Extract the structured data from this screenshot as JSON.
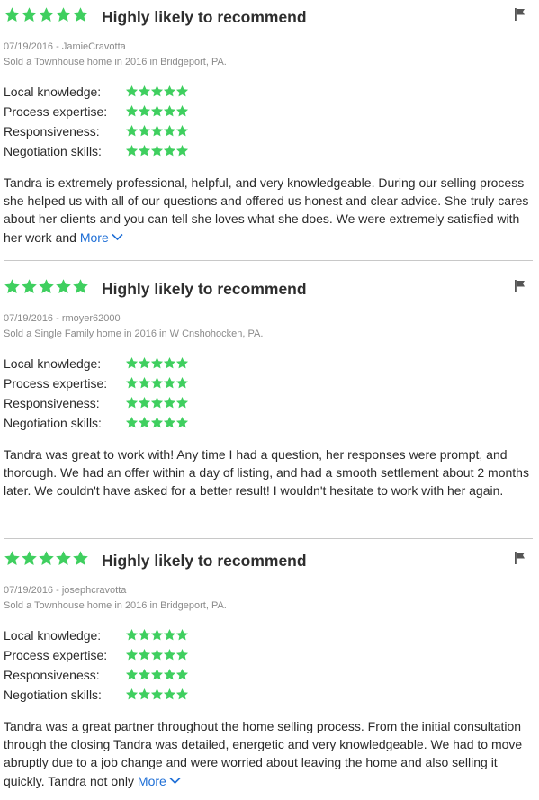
{
  "colors": {
    "star": "#3fcf5f",
    "link": "#1f6fd6",
    "meta": "#8a8a8a"
  },
  "icons": {
    "rating": "star-icon",
    "report": "flag-icon",
    "expand": "chevron-down-icon"
  },
  "reviews": [
    {
      "overall_stars": 5,
      "headline": "Highly likely to recommend",
      "date_user": "07/19/2016 - JamieCravotta",
      "transaction": "Sold a Townhouse home in 2016 in Bridgeport, PA.",
      "ratings": [
        {
          "label": "Local knowledge:",
          "stars": 5
        },
        {
          "label": "Process expertise:",
          "stars": 5
        },
        {
          "label": "Responsiveness:",
          "stars": 5
        },
        {
          "label": "Negotiation skills:",
          "stars": 5
        }
      ],
      "text": "Tandra is extremely professional, helpful, and very knowledgeable. During our selling process she helped us with all of our questions and offered us honest and clear advice. She truly cares about her clients and you can tell she loves what she does. We were extremely satisfied with her work and",
      "more_label": "More"
    },
    {
      "overall_stars": 5,
      "headline": "Highly likely to recommend",
      "date_user": "07/19/2016 - rmoyer62000",
      "transaction": "Sold a Single Family home in 2016 in W Cnshohocken, PA.",
      "ratings": [
        {
          "label": "Local knowledge:",
          "stars": 5
        },
        {
          "label": "Process expertise:",
          "stars": 5
        },
        {
          "label": "Responsiveness:",
          "stars": 5
        },
        {
          "label": "Negotiation skills:",
          "stars": 5
        }
      ],
      "text": "Tandra was great to work with!  Any time I had a question, her responses were prompt, and thorough.  We had an offer within a day of listing, and had a smooth settlement about 2 months later.  We couldn't have asked for a better result!  I wouldn't hesitate to work with her again.",
      "more_label": ""
    },
    {
      "overall_stars": 5,
      "headline": "Highly likely to recommend",
      "date_user": "07/19/2016 - josephcravotta",
      "transaction": "Sold a Townhouse home in 2016 in Bridgeport, PA.",
      "ratings": [
        {
          "label": "Local knowledge:",
          "stars": 5
        },
        {
          "label": "Process expertise:",
          "stars": 5
        },
        {
          "label": "Responsiveness:",
          "stars": 5
        },
        {
          "label": "Negotiation skills:",
          "stars": 5
        }
      ],
      "text": "Tandra was a great partner throughout the home selling process. From the initial consultation through the closing Tandra was detailed, energetic and very knowledgeable.  We had to move abruptly due to a job change and were worried about leaving the home and also selling it quickly.  Tandra not only",
      "more_label": "More"
    }
  ]
}
